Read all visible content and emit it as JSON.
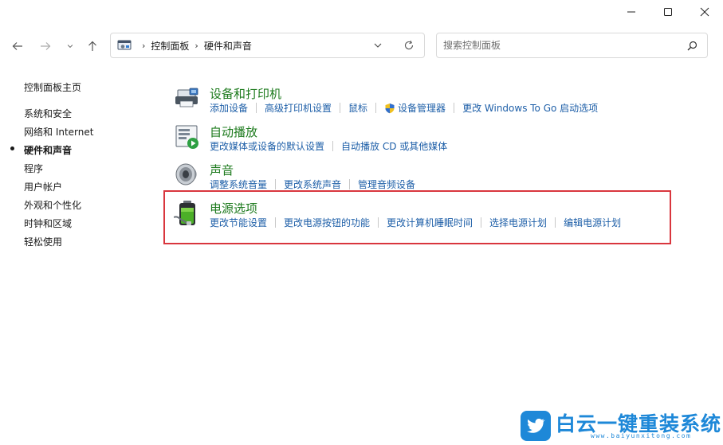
{
  "window": {
    "controls": [
      "minimize",
      "maximize",
      "close"
    ]
  },
  "nav": {
    "breadcrumb": [
      "控制面板",
      "硬件和声音"
    ],
    "search_placeholder": "搜索控制面板"
  },
  "sidebar": {
    "items": [
      {
        "label": "控制面板主页"
      },
      {
        "label": "系统和安全"
      },
      {
        "label": "网络和 Internet"
      },
      {
        "label": "硬件和声音"
      },
      {
        "label": "程序"
      },
      {
        "label": "用户帐户"
      },
      {
        "label": "外观和个性化"
      },
      {
        "label": "时钟和区域"
      },
      {
        "label": "轻松使用"
      }
    ],
    "active_index": 3
  },
  "categories": [
    {
      "title": "设备和打印机",
      "icon": "printer-icon",
      "links": [
        "添加设备",
        "高级打印机设置",
        "鼠标",
        "设备管理器",
        "更改 Windows To Go 启动选项"
      ]
    },
    {
      "title": "自动播放",
      "icon": "autoplay-icon",
      "links": [
        "更改媒体或设备的默认设置",
        "自动播放 CD 或其他媒体"
      ]
    },
    {
      "title": "声音",
      "icon": "speaker-icon",
      "links": [
        "调整系统音量",
        "更改系统声音",
        "管理音频设备"
      ]
    },
    {
      "title": "电源选项",
      "icon": "battery-icon",
      "links": [
        "更改节能设置",
        "更改电源按钮的功能",
        "更改计算机睡眠时间",
        "选择电源计划",
        "编辑电源计划"
      ]
    }
  ],
  "colors": {
    "category_title": "#1e7b1e",
    "link": "#1e5fa8",
    "highlight_border": "#d9363e",
    "watermark": "#1e88d8"
  },
  "watermark": {
    "title": "白云一键重装系统",
    "url": "www.baiyunxitong.com"
  }
}
